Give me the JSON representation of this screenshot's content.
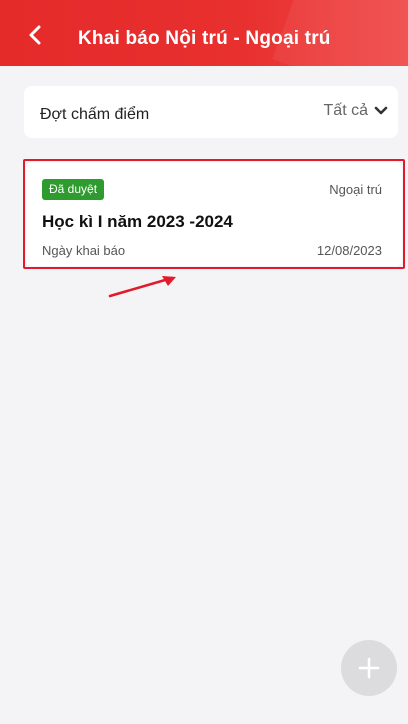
{
  "header": {
    "title": "Khai báo Nội trú - Ngoại trú",
    "back_icon": "chevron-left-icon"
  },
  "filter": {
    "label": "Đợt chấm điểm",
    "value": "Tất cả",
    "icon": "chevron-down-icon"
  },
  "records": [
    {
      "status": "Đã duyệt",
      "type": "Ngoại trú",
      "title": "Học kì I năm 2023 -2024",
      "date_label": "Ngày khai báo",
      "date": "12/08/2023"
    }
  ],
  "fab": {
    "icon": "plus-icon"
  },
  "colors": {
    "header": "#e52a2a",
    "status_approved": "#2e9b2e",
    "annotation": "#e11b2c",
    "background": "#f4f4f7"
  }
}
